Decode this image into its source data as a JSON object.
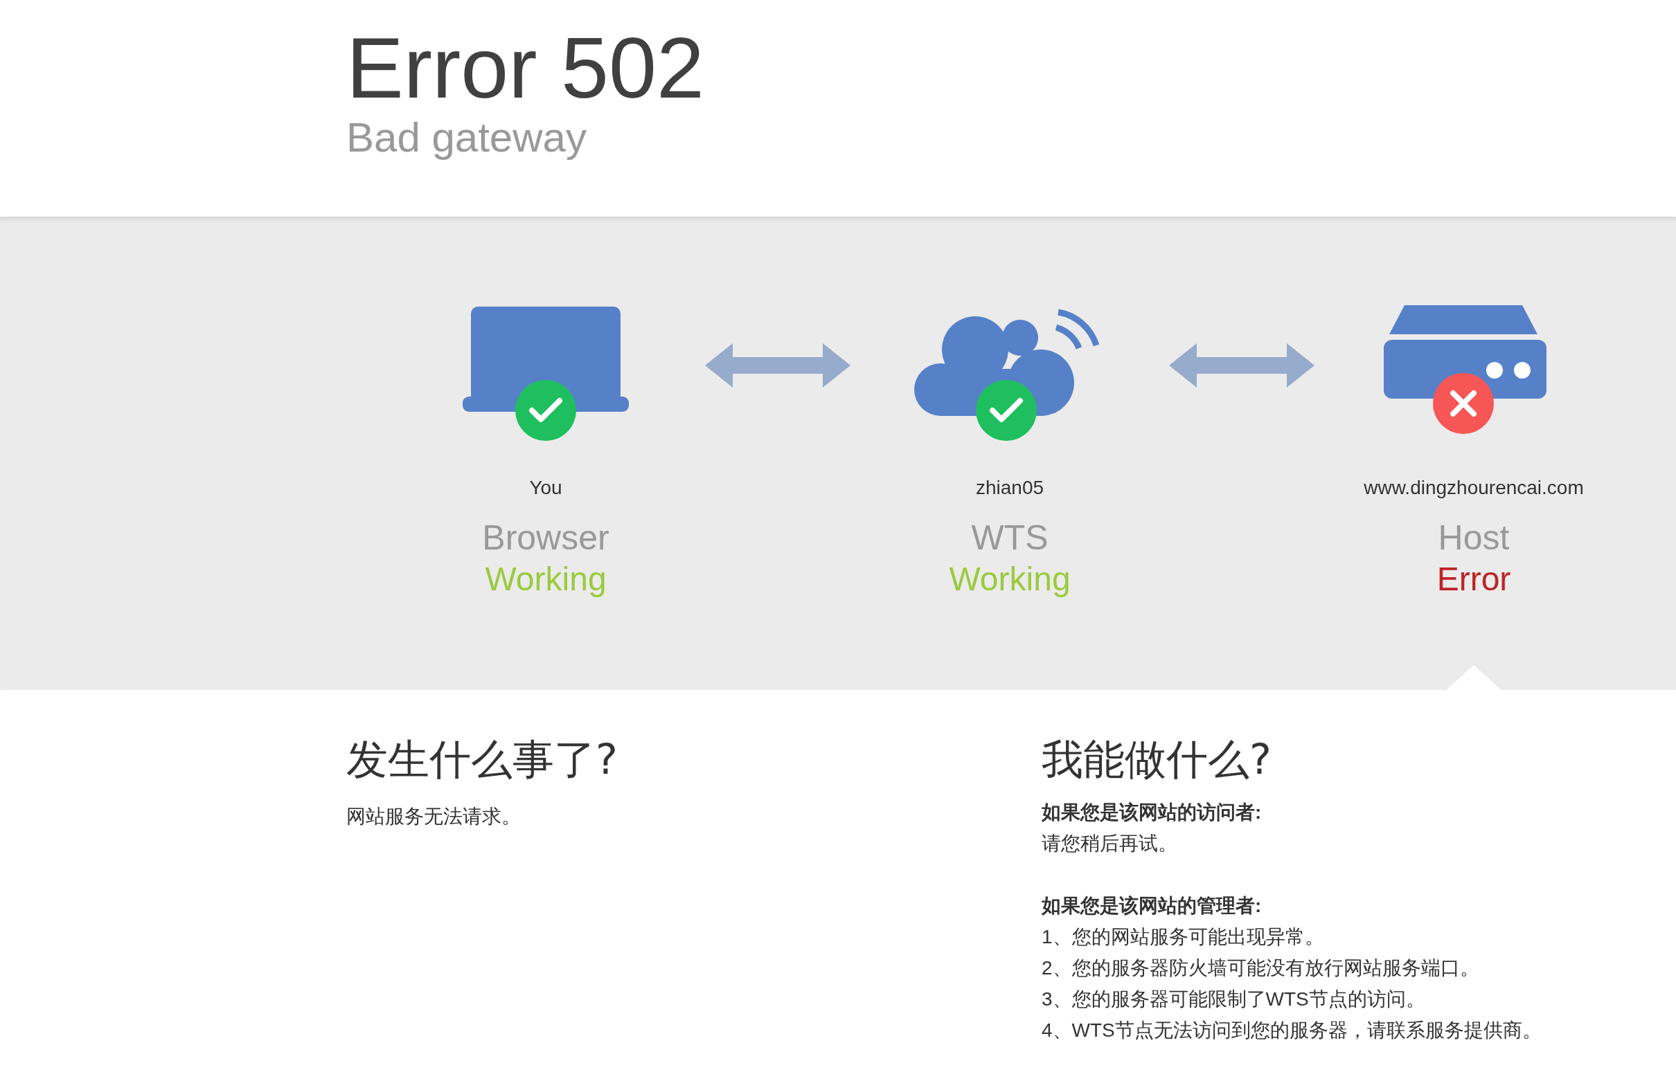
{
  "header": {
    "title": "Error 502",
    "subtitle": "Bad gateway"
  },
  "nodes": [
    {
      "kind": "browser",
      "name": "You",
      "type": "Browser",
      "status": "Working",
      "ok": true,
      "highlighted": false
    },
    {
      "kind": "cloud",
      "name": "zhian05",
      "type": "WTS",
      "status": "Working",
      "ok": true,
      "highlighted": false
    },
    {
      "kind": "server",
      "name": "www.dingzhourencai.com",
      "type": "Host",
      "status": "Error",
      "ok": false,
      "highlighted": true
    }
  ],
  "what_happened": {
    "heading": "发生什么事了?",
    "text": "网站服务无法请求。"
  },
  "what_can_i_do": {
    "heading": "我能做什么?",
    "groups": [
      {
        "title": "如果您是该网站的访问者:",
        "lines": [
          "请您稍后再试。"
        ]
      },
      {
        "title": "如果您是该网站的管理者:",
        "lines": [
          "1、您的网站服务可能出现异常。",
          "2、您的服务器防火墙可能没有放行网站服务端口。",
          "3、您的服务器可能限制了WTS节点的访问。",
          "4、WTS节点无法访问到您的服务器，请联系服务提供商。"
        ]
      }
    ]
  }
}
